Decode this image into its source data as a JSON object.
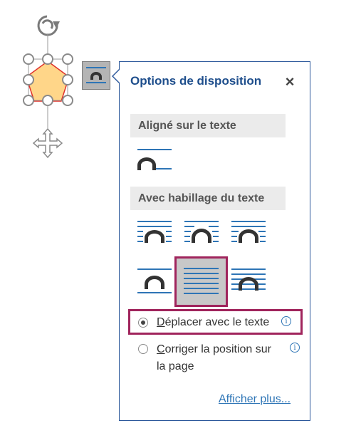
{
  "panel": {
    "title": "Options de disposition",
    "close_icon": "×",
    "section_inline": "Aligné sur le texte",
    "section_wrap": "Avec habillage du texte",
    "wrap_options": [
      "inline-with-text",
      "square",
      "tight",
      "through",
      "top-and-bottom",
      "behind-text",
      "in-front-of-text"
    ],
    "selected_wrap": "behind-text",
    "radio_move_first": "D",
    "radio_move_rest": "éplacer avec le texte",
    "radio_move_selected": true,
    "radio_fix_first": "C",
    "radio_fix_line1_rest": "orriger la position sur",
    "radio_fix_line2": "la page",
    "radio_fix_selected": false,
    "info_glyph": "i",
    "more_link": "Afficher plus..."
  },
  "colors": {
    "accent": "#2b579a",
    "title": "#1e4e8c",
    "highlight": "#a0245c",
    "shape_fill": "#ffd689",
    "shape_stroke": "#e0302a",
    "lines": "#2e75b6"
  }
}
